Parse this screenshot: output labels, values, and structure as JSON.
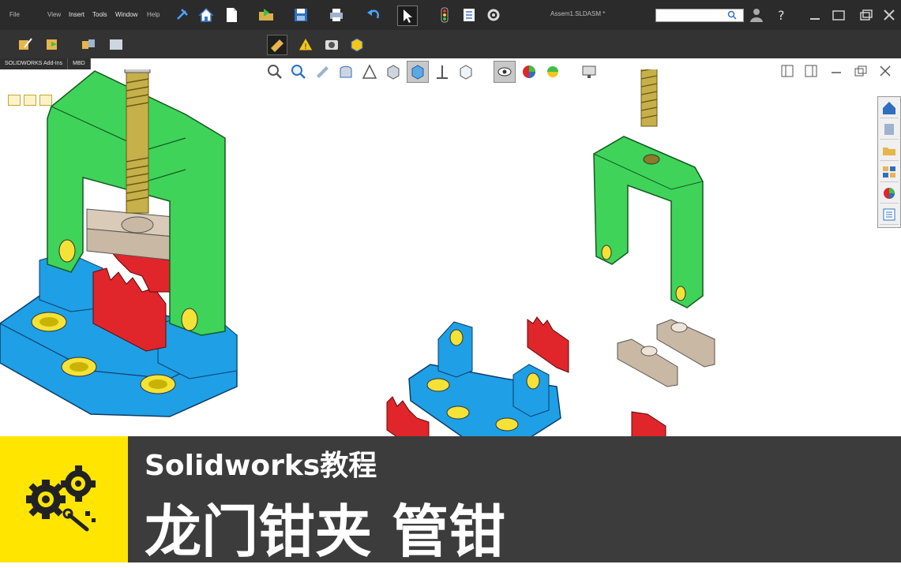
{
  "menubar": {
    "items": [
      "File",
      "View",
      "Insert",
      "Tools",
      "Window",
      "Help"
    ]
  },
  "document": {
    "title": "Assem1.SLDASM *"
  },
  "search": {
    "placeholder": ""
  },
  "tabs": [
    {
      "label": "SOLIDWORKS Add-Ins"
    },
    {
      "label": "MBD"
    }
  ],
  "banner": {
    "subtitle": "Solidworks教程",
    "title": "龙门钳夹 管钳"
  },
  "colors": {
    "frame_green": "#3fd35a",
    "base_blue": "#1f9fe6",
    "jaw_red": "#e0262b",
    "part_beige": "#c9b8a3",
    "screw_yellow": "#c6b04a",
    "banner_gray": "#3c3c3c",
    "logo_yellow": "#ffe500"
  },
  "icons": {
    "toolbar": [
      "home-icon",
      "new-document-icon",
      "open-icon",
      "save-icon",
      "print-icon",
      "undo-icon",
      "select-icon",
      "rebuild-icon",
      "file-properties-icon",
      "options-icon"
    ],
    "headsup": [
      "zoom-to-fit-icon",
      "zoom-area-icon",
      "previous-view-icon",
      "section-view-icon",
      "dynamic-annotation-icon",
      "view-orientation-icon",
      "display-style-icon",
      "hide-show-icon",
      "edit-appearance-icon",
      "apply-scene-icon",
      "view-settings-icon"
    ],
    "taskpane": [
      "solidworks-resources-icon",
      "design-library-icon",
      "file-explorer-icon",
      "view-palette-icon",
      "appearances-icon",
      "custom-properties-icon"
    ]
  }
}
